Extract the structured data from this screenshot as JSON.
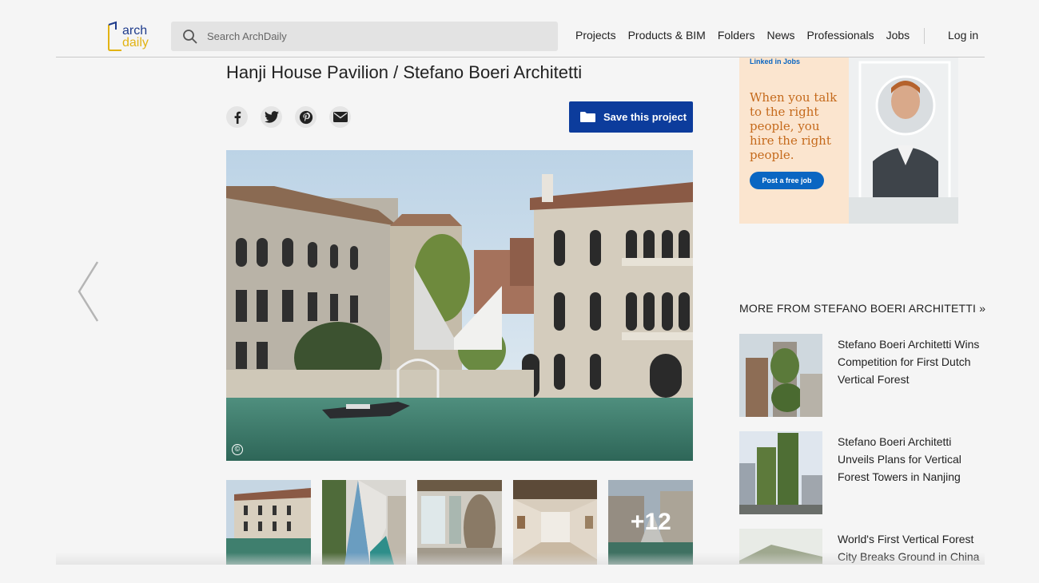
{
  "logo": {
    "line1": "arch",
    "line2": "daily"
  },
  "search": {
    "placeholder": "Search ArchDaily"
  },
  "nav": {
    "items": [
      "Projects",
      "Products & BIM",
      "Folders",
      "News",
      "Professionals",
      "Jobs"
    ],
    "login": "Log in"
  },
  "article": {
    "title": "Hanji House Pavilion / Stefano Boeri Architetti",
    "save_label": "Save this project",
    "share_icons": [
      "facebook-icon",
      "twitter-icon",
      "pinterest-icon",
      "email-icon"
    ],
    "copyright_symbol": "©",
    "more_photos": "+12"
  },
  "ad": {
    "brand": "Linked in Jobs",
    "headline": "When you talk to the right people, you hire the right people.",
    "cta": "Post a free job"
  },
  "more": {
    "heading": "MORE FROM STEFANO BOERI ARCHITETTI »",
    "items": [
      {
        "title": "Stefano Boeri Architetti Wins Competition for First Dutch Vertical Forest"
      },
      {
        "title": "Stefano Boeri Architetti Unveils Plans for Vertical Forest Towers in Nanjing"
      },
      {
        "title": "World's First Vertical Forest City Breaks Ground in China"
      }
    ]
  },
  "colors": {
    "accent": "#0c3c9c",
    "logo_blue": "#1f3c8c",
    "logo_yellow": "#e2b313"
  }
}
